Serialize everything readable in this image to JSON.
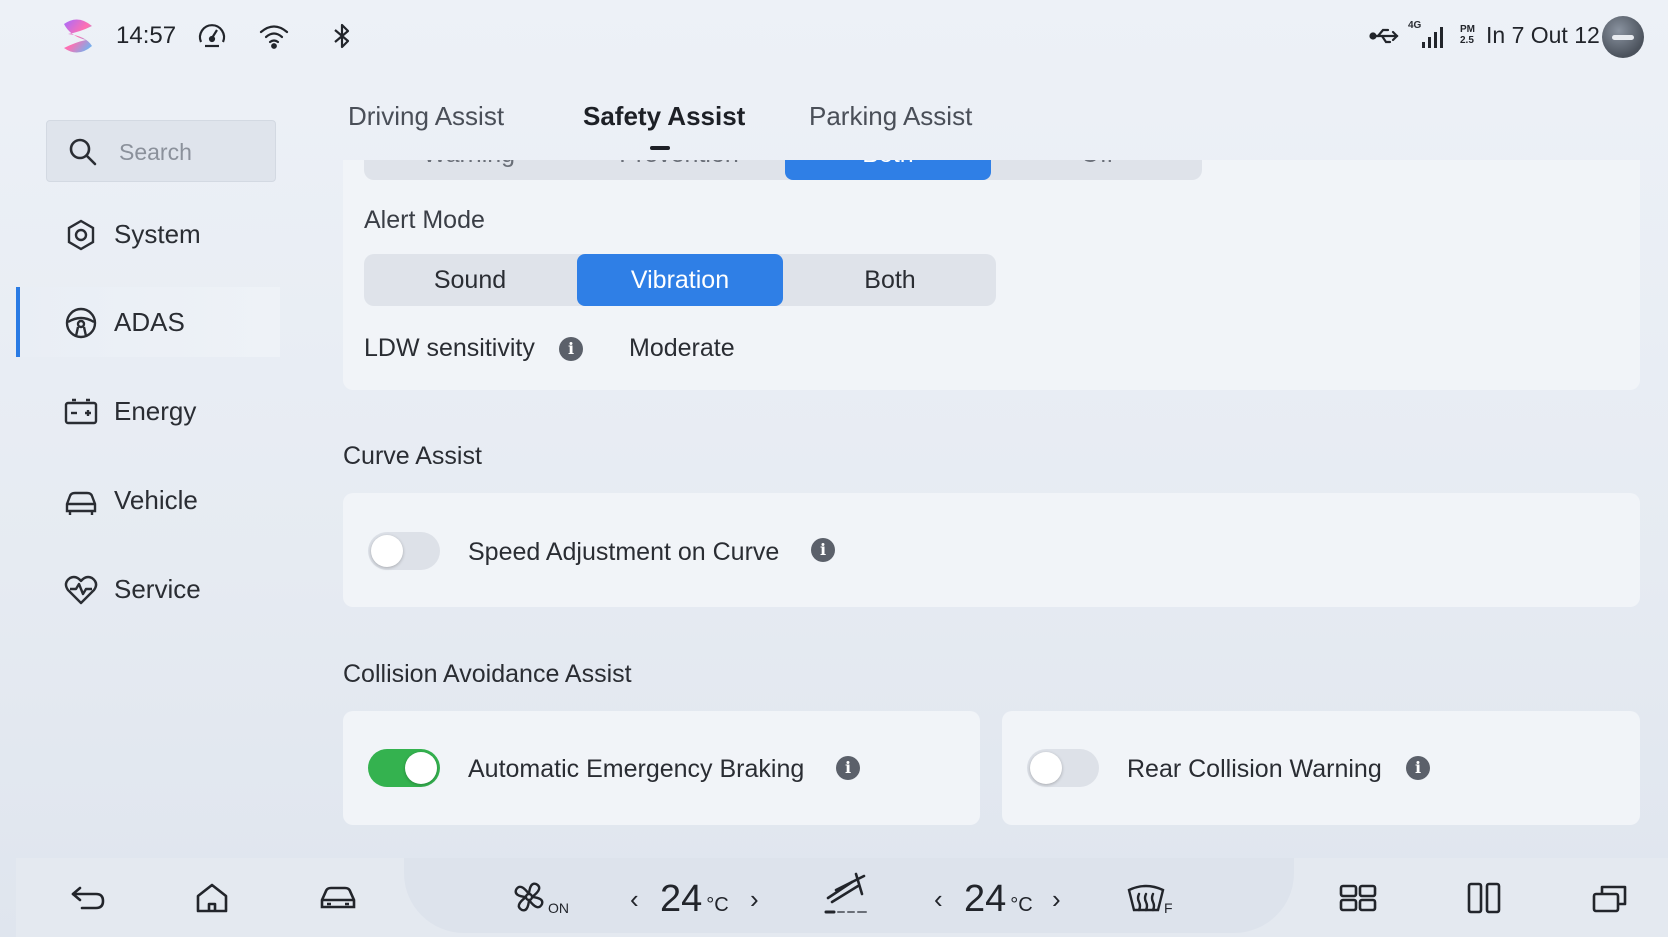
{
  "status_bar": {
    "time": "14:57",
    "icons": [
      "app-logo",
      "speed-gauge-icon",
      "wifi-icon",
      "bluetooth-icon",
      "usb-icon",
      "4g-signal-icon",
      "pm25-icon"
    ],
    "network_label": "4G",
    "pm_label": "PM",
    "pm_value": "2.5",
    "air_quality": "In 7 Out 12"
  },
  "sidebar": {
    "search_placeholder": "Search",
    "items": [
      {
        "label": "System",
        "icon": "gear-hex-icon"
      },
      {
        "label": "ADAS",
        "icon": "steering-wheel-icon",
        "active": true
      },
      {
        "label": "Energy",
        "icon": "battery-icon"
      },
      {
        "label": "Vehicle",
        "icon": "car-icon"
      },
      {
        "label": "Service",
        "icon": "heart-pulse-icon"
      }
    ]
  },
  "tabs": [
    {
      "label": "Driving Assist"
    },
    {
      "label": "Safety Assist",
      "active": true
    },
    {
      "label": "Parking Assist"
    }
  ],
  "top_segment": {
    "options": [
      "Warning",
      "Prevention",
      "Both",
      "Off"
    ],
    "selected": "Both"
  },
  "alert_mode": {
    "title": "Alert Mode",
    "options": [
      "Sound",
      "Vibration",
      "Both"
    ],
    "selected": "Vibration"
  },
  "ldw": {
    "label": "LDW sensitivity",
    "value": "Moderate"
  },
  "curve_assist": {
    "title": "Curve Assist",
    "speed_adjustment": {
      "label": "Speed Adjustment on Curve",
      "enabled": false
    }
  },
  "collision_avoidance": {
    "title": "Collision Avoidance Assist",
    "aeb": {
      "label": "Automatic Emergency Braking",
      "enabled": true
    },
    "rear_collision": {
      "label": "Rear Collision Warning",
      "enabled": false
    }
  },
  "bottom_bar": {
    "fan_status": "ON",
    "left_temp": "24",
    "right_temp": "24",
    "temp_unit": "°C",
    "defrost_label": "F"
  },
  "colors": {
    "accent": "#2f7fe6",
    "toggle_on": "#34b24f",
    "active_nav_bar": "#2a7be4"
  }
}
